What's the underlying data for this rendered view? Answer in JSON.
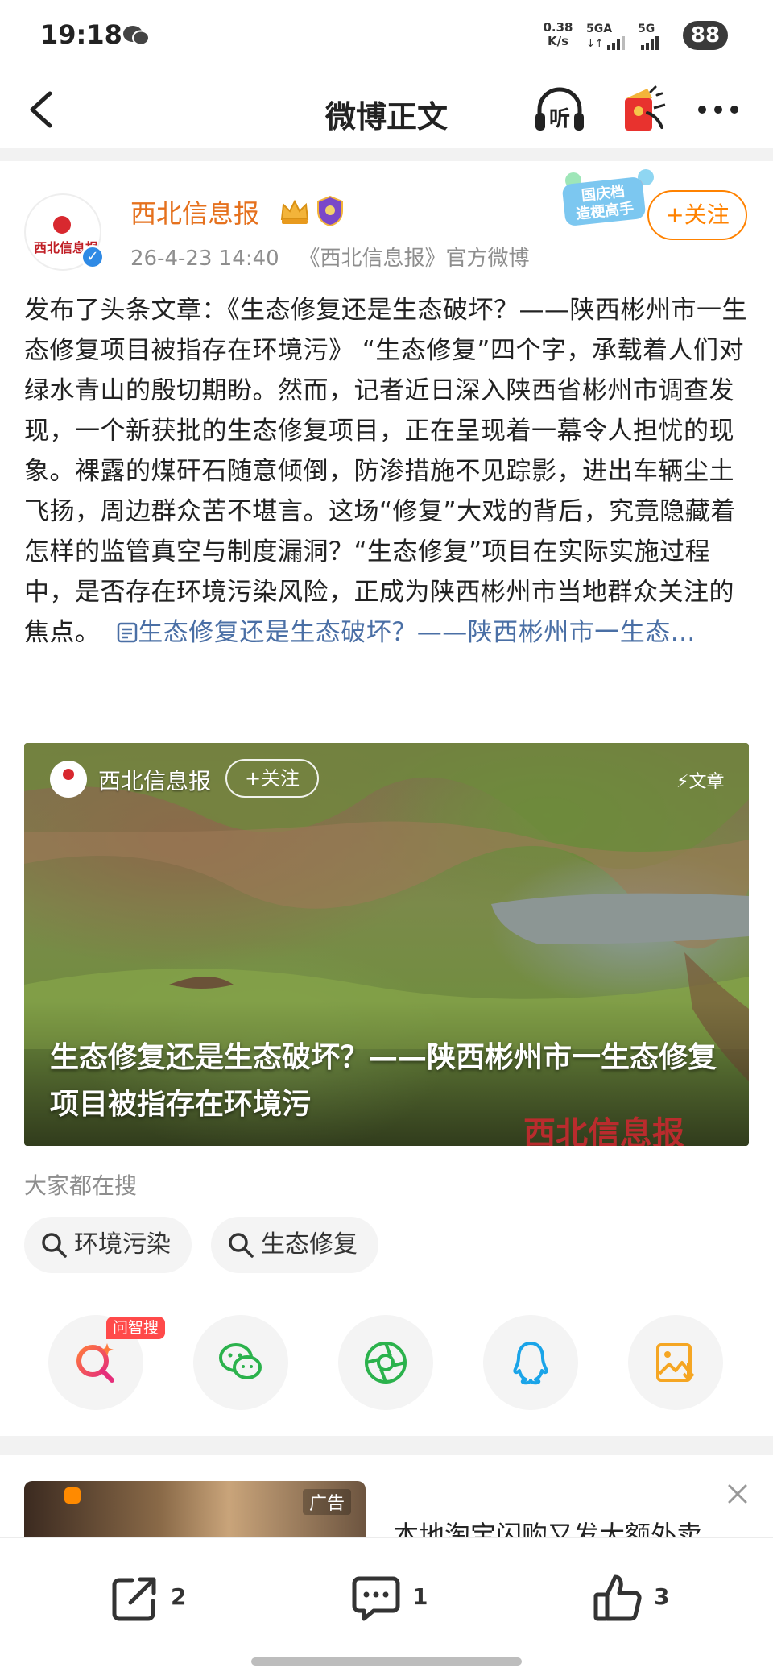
{
  "status_bar": {
    "time": "19:18",
    "net_speed_value": "0.38",
    "net_speed_unit": "K/s",
    "signal_1": "5GA",
    "signal_2": "5G",
    "battery": "88"
  },
  "header": {
    "title": "微博正文",
    "listen_label": "听"
  },
  "post": {
    "author": "西北信息报",
    "avatar_text": "西北信息报",
    "date": "26-4-23 14:40",
    "source": "《西北信息报》官方微博",
    "follow_label": "+关注",
    "holiday_badge": "国庆档\n造梗高手",
    "text": "发布了头条文章：《生态修复还是生态破坏？——陕西彬州市一生态修复项目被指存在环境污》 “生态修复”四个字，承载着人们对绿水青山的殷切期盼。然而，记者近日深入陕西省彬州市调查发现，一个新获批的生态修复项目，正在呈现着一幕令人担忧的现象。裸露的煤矸石随意倾倒，防渗措施不见踪影，进出车辆尘土飞扬，周边群众苦不堪言。这场“修复”大戏的背后，究竟隐藏着怎样的监管真空与制度漏洞？“生态修复”项目在实际实施过程中，是否存在环境污染风险，正成为陕西彬州市当地群众关注的焦点。",
    "link_text": "生态修复还是生态破坏？——陕西彬州市一生态..."
  },
  "article_card": {
    "author": "西北信息报",
    "follow_label": "+关注",
    "type_label": "文章",
    "title": "生态修复还是生态破坏？——陕西彬州市一生态修复项目被指存在环境污",
    "watermark": "西北信息报"
  },
  "hot_search": {
    "label": "大家都在搜",
    "chips": [
      "环境污染",
      "生态修复"
    ]
  },
  "share": {
    "wenzhi_tag": "问智搜",
    "items": [
      "wenzhi-search-icon",
      "wechat-icon",
      "moments-icon",
      "qq-icon",
      "save-image-icon"
    ]
  },
  "ad": {
    "label": "广告",
    "title": "本地淘宝闪购又发大额外卖"
  },
  "bottom_bar": {
    "repost_count": "2",
    "comment_count": "1",
    "like_count": "3"
  },
  "colors": {
    "accent_orange": "#ff8200",
    "author_orange": "#e5711e",
    "link_blue": "#4a6fa5",
    "verified_blue": "#2f8ae5"
  }
}
